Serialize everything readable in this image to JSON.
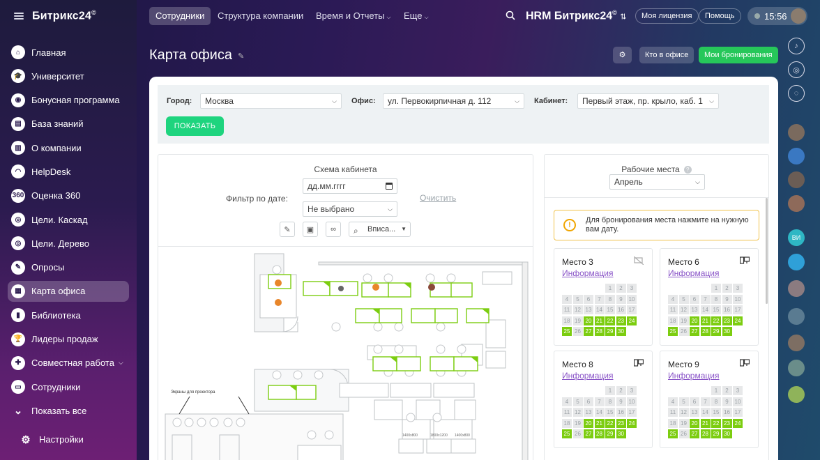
{
  "brand": {
    "logo": "Битрикс24",
    "logo_mark": "©"
  },
  "sidebar": {
    "items": [
      {
        "label": "Главная",
        "icon": "home-icon",
        "glyph": "⌂"
      },
      {
        "label": "Университет",
        "icon": "graduation-cap-icon",
        "glyph": "🎓"
      },
      {
        "label": "Бонусная программа",
        "icon": "gamepad-icon",
        "glyph": "◉"
      },
      {
        "label": "База знаний",
        "icon": "book-icon",
        "glyph": "▤"
      },
      {
        "label": "О компании",
        "icon": "building-icon",
        "glyph": "▥"
      },
      {
        "label": "HelpDesk",
        "icon": "headset-icon",
        "glyph": "◠"
      },
      {
        "label": "Оценка 360",
        "icon": "rating-360-icon",
        "glyph": "360"
      },
      {
        "label": "Цели. Каскад",
        "icon": "target-icon",
        "glyph": "◎"
      },
      {
        "label": "Цели. Дерево",
        "icon": "goal-tree-icon",
        "glyph": "◎"
      },
      {
        "label": "Опросы",
        "icon": "poll-icon",
        "glyph": "✎"
      },
      {
        "label": "Карта офиса",
        "icon": "office-map-icon",
        "glyph": "▦",
        "active": true
      },
      {
        "label": "Библиотека",
        "icon": "library-icon",
        "glyph": "▮"
      },
      {
        "label": "Лидеры продаж",
        "icon": "trophy-icon",
        "glyph": "🏆"
      },
      {
        "label": "Совместная работа",
        "icon": "collaboration-icon",
        "glyph": "✚",
        "expand": true
      },
      {
        "label": "Сотрудники",
        "icon": "employees-icon",
        "glyph": "▭"
      }
    ],
    "show_all": "Показать все",
    "settings": "Настройки"
  },
  "topnav": {
    "tabs": [
      {
        "label": "Сотрудники",
        "active": true
      },
      {
        "label": "Структура компании"
      },
      {
        "label": "Время и Отчеты",
        "dropdown": true
      },
      {
        "label": "Еще",
        "dropdown": true
      }
    ],
    "portal_title": "HRM Битрикс24",
    "license": "Моя лицензия",
    "help": "Помощь",
    "time": "15:56"
  },
  "page": {
    "title": "Карта офиса",
    "who_in_office": "Кто в офисе",
    "my_bookings": "Мои бронирования"
  },
  "filters": {
    "city_label": "Город:",
    "city_value": "Москва",
    "office_label": "Офис:",
    "office_value": "ул. Первокирпичная д. 112",
    "cabinet_label": "Кабинет:",
    "cabinet_value": "Первый этаж, пр. крыло, каб. 1",
    "show_button": "ПОКАЗАТЬ"
  },
  "scheme": {
    "title": "Схема кабинета",
    "date_filter_label": "Фильтр по дате:",
    "date_placeholder": "дд.мм.гггг",
    "select_value": "Не выбрано",
    "clear_link": "Очистить",
    "zoom_value": "Вписа...",
    "plan_label_projectors": "Экраны для проектора",
    "plan_table_labels": [
      "1400x800",
      "1800x1200",
      "1400x800"
    ]
  },
  "places": {
    "title": "Рабочие места",
    "help_mark": "?",
    "month": "Апрель",
    "notice": "Для бронирования места нажмите на нужную вам дату.",
    "seats": [
      {
        "name": "Место 3",
        "info": "Информация",
        "device": "no-monitor-icon"
      },
      {
        "name": "Место 6",
        "info": "Информация",
        "device": "monitor-icon"
      },
      {
        "name": "Место 8",
        "info": "Информация",
        "device": "monitor-icon"
      },
      {
        "name": "Место 9",
        "info": "Информация",
        "device": "monitor-icon"
      }
    ],
    "calendar_days": [
      1,
      2,
      3,
      4,
      5,
      6,
      7,
      8,
      9,
      10,
      11,
      12,
      13,
      14,
      15,
      16,
      17,
      18,
      19,
      20,
      21,
      22,
      23,
      24,
      25,
      26,
      27,
      28,
      29,
      30
    ],
    "free_days_by_seat": [
      [
        20,
        21,
        22,
        23,
        24,
        25,
        27,
        28,
        29,
        30
      ],
      [
        20,
        21,
        22,
        23,
        24,
        25,
        27,
        28,
        29,
        30
      ],
      [
        20,
        21,
        22,
        23,
        24,
        25,
        27,
        28,
        29,
        30
      ],
      [
        20,
        21,
        22,
        23,
        24,
        25,
        27,
        28,
        29,
        30
      ]
    ]
  },
  "colors": {
    "accent_green": "#1ed47e",
    "free_day": "#7ccd10",
    "seat_green": "#7ccd10",
    "link": "#8a55c8"
  }
}
